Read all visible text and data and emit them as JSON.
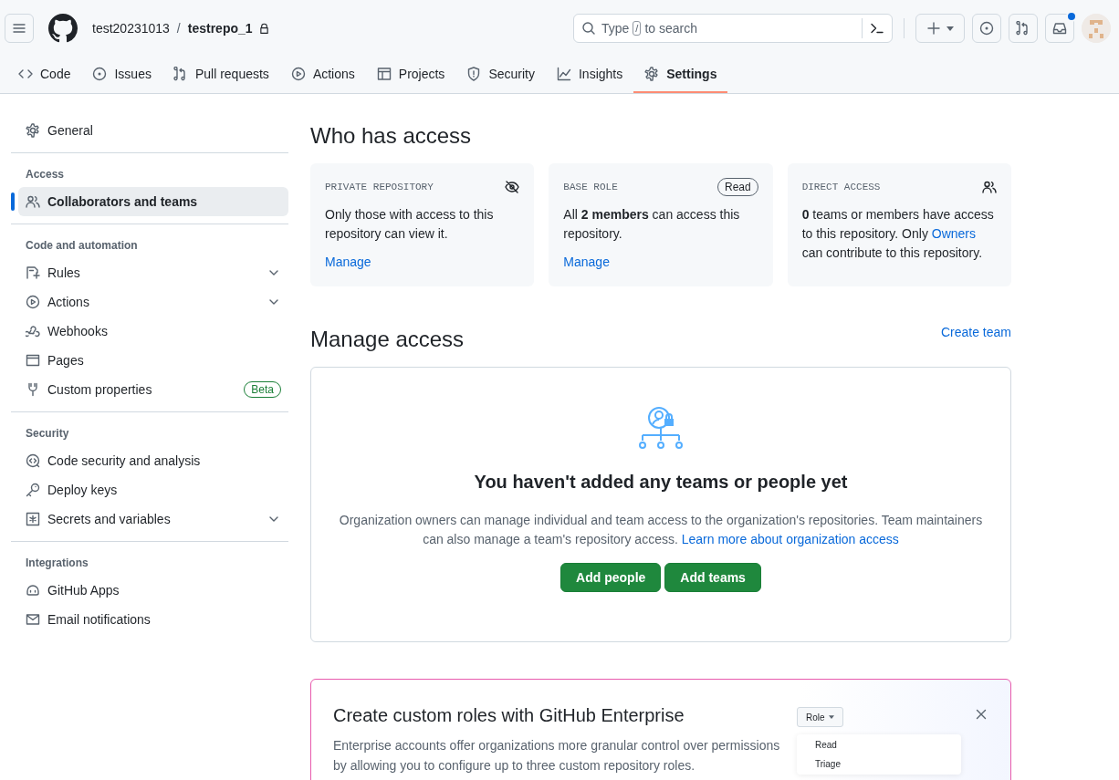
{
  "header": {
    "owner": "test20231013",
    "separator": "/",
    "repo": "testrepo_1",
    "private": true,
    "search": {
      "before": "Type",
      "key": "/",
      "after": "to search"
    },
    "notifications_unread": true
  },
  "tabs": [
    {
      "label": "Code",
      "selected": false
    },
    {
      "label": "Issues",
      "selected": false
    },
    {
      "label": "Pull requests",
      "selected": false
    },
    {
      "label": "Actions",
      "selected": false
    },
    {
      "label": "Projects",
      "selected": false
    },
    {
      "label": "Security",
      "selected": false
    },
    {
      "label": "Insights",
      "selected": false
    },
    {
      "label": "Settings",
      "selected": true
    }
  ],
  "sidebar": {
    "sections": [
      {
        "items": [
          {
            "label": "General",
            "kind": "link",
            "selected": false
          }
        ]
      },
      {
        "heading": "Access",
        "items": [
          {
            "label": "Collaborators and teams",
            "kind": "link",
            "selected": true
          }
        ]
      },
      {
        "heading": "Code and automation",
        "items": [
          {
            "label": "Rules",
            "kind": "group",
            "selected": false
          },
          {
            "label": "Actions",
            "kind": "group",
            "selected": false
          },
          {
            "label": "Webhooks",
            "kind": "link",
            "selected": false
          },
          {
            "label": "Pages",
            "kind": "link",
            "selected": false
          },
          {
            "label": "Custom properties",
            "kind": "link",
            "selected": false,
            "badge": "Beta"
          }
        ]
      },
      {
        "heading": "Security",
        "items": [
          {
            "label": "Code security and analysis",
            "kind": "link",
            "selected": false
          },
          {
            "label": "Deploy keys",
            "kind": "link",
            "selected": false
          },
          {
            "label": "Secrets and variables",
            "kind": "group",
            "selected": false
          }
        ]
      },
      {
        "heading": "Integrations",
        "items": [
          {
            "label": "GitHub Apps",
            "kind": "link",
            "selected": false
          },
          {
            "label": "Email notifications",
            "kind": "link",
            "selected": false
          }
        ]
      }
    ]
  },
  "access": {
    "title": "Who has access",
    "cards": [
      {
        "heading": "PRIVATE REPOSITORY",
        "text": "Only those with access to this repository can view it.",
        "link": "Manage"
      },
      {
        "heading": "BASE ROLE",
        "badge": "Read",
        "text": "All **2 members** can access this repository.",
        "link": "Manage"
      },
      {
        "heading": "DIRECT ACCESS",
        "text": "**0** teams or members have access to this repository. Only",
        "inline_link": "Owners",
        "text_after": "can contribute to this repository."
      }
    ]
  },
  "manage": {
    "title": "Manage access",
    "action": "Create team",
    "empty": {
      "title": "You haven't added any teams or people yet",
      "text": "Organization owners can manage individual and team access to the organization's repositories. Team maintainers can also manage a team's repository access.",
      "link": "Learn more about organization access",
      "buttons": [
        "Add people",
        "Add teams"
      ]
    }
  },
  "promo": {
    "title": "Create custom roles with GitHub Enterprise",
    "text": "Enterprise accounts offer organizations more granular control over permissions by allowing you to configure up to three custom repository roles.",
    "role_button": "Role",
    "role_options": [
      "Read",
      "Triage"
    ]
  }
}
